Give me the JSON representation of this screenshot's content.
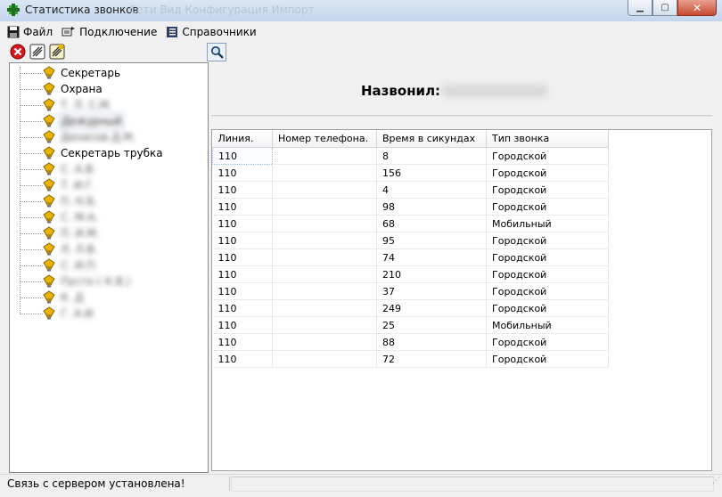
{
  "window": {
    "title": "Статистика звонков",
    "title_ghost": "Сети  Вид  Конфигурация  Импорт"
  },
  "menu": [
    {
      "label": "Файл",
      "icon": "save-icon"
    },
    {
      "label": "Подключение",
      "icon": "connect-icon"
    },
    {
      "label": "Справочники",
      "icon": "book-icon"
    }
  ],
  "tree": [
    {
      "label": "Секретарь",
      "blurred": false
    },
    {
      "label": "Охрана",
      "blurred": false
    },
    {
      "label": "Т.  Л.   С.М.",
      "blurred": true
    },
    {
      "label": "Дежурный",
      "blurred": true,
      "selected": true
    },
    {
      "label": "Денисов Д.М.",
      "blurred": true
    },
    {
      "label": "Секретарь трубка",
      "blurred": false
    },
    {
      "label": "С.      А.В.",
      "blurred": true
    },
    {
      "label": "Т.    И.Г.",
      "blurred": true
    },
    {
      "label": "П.      Н.Б.",
      "blurred": true
    },
    {
      "label": "С.       М.А.",
      "blurred": true
    },
    {
      "label": "П.    И.М.",
      "blurred": true
    },
    {
      "label": "Л.    Л.В.",
      "blurred": true
    },
    {
      "label": "С.    И.П.",
      "blurred": true
    },
    {
      "label": "Пусто (              К.В.)",
      "blurred": true
    },
    {
      "label": "К.       Д",
      "blurred": true
    },
    {
      "label": "Г.    А.И.",
      "blurred": true
    }
  ],
  "header": {
    "title": "Назвонил:"
  },
  "table": {
    "columns": [
      "Линия.",
      "Номер телефона.",
      "Время в сикундах",
      "Тип звонка"
    ],
    "rows": [
      [
        "110",
        "",
        "8",
        "Городской"
      ],
      [
        "110",
        "",
        "156",
        "Городской"
      ],
      [
        "110",
        "",
        "4",
        "Городской"
      ],
      [
        "110",
        "",
        "98",
        "Городской"
      ],
      [
        "110",
        "",
        "68",
        "Мобильный"
      ],
      [
        "110",
        "",
        "95",
        "Городской"
      ],
      [
        "110",
        "",
        "74",
        "Городской"
      ],
      [
        "110",
        "",
        "210",
        "Городской"
      ],
      [
        "110",
        "",
        "37",
        "Городской"
      ],
      [
        "110",
        "",
        "249",
        "Городской"
      ],
      [
        "110",
        "",
        "25",
        "Мобильный"
      ],
      [
        "110",
        "",
        "88",
        "Городской"
      ],
      [
        "110",
        "",
        "72",
        "Городской"
      ]
    ]
  },
  "status": {
    "text": "Связь с сервером установлена!"
  },
  "colors": {
    "titlebar": "#c3d6ec",
    "close": "#c54a32",
    "bulb": "#e8b400"
  }
}
